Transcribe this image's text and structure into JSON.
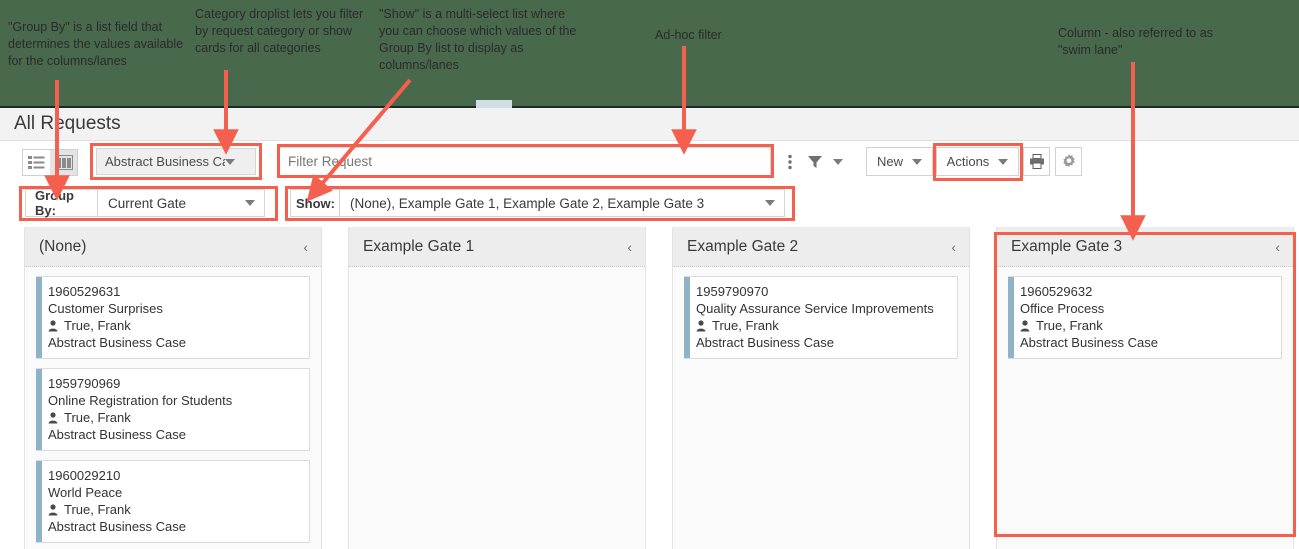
{
  "annotations": [
    {
      "id": "group-by-note",
      "text": "\"Group By\" is a list field that determines the values available for the columns/lanes"
    },
    {
      "id": "category-note",
      "text": "Category droplist lets you filter by request category or show cards for all categories"
    },
    {
      "id": "show-note",
      "text": "\"Show\" is a multi-select list where you can choose which values of the Group By list to display as columns/lanes"
    },
    {
      "id": "adhoc-filter-note",
      "text": "Ad-hoc filter"
    },
    {
      "id": "column-note",
      "text": "Column - also referred to as \"swim lane\""
    }
  ],
  "header": {
    "title": "All Requests"
  },
  "toolbar": {
    "view_list_icon": "list-view-icon",
    "view_card_icon": "card-view-icon",
    "category_value": "Abstract Business Case",
    "filter_placeholder": "Filter Request",
    "filter_value": "",
    "more_icon": "vertical-dots-icon",
    "funnel_icon": "funnel-icon",
    "funnel_caret_icon": "chevron-down-icon",
    "new_label": "New",
    "actions_label": "Actions",
    "print_icon": "printer-icon",
    "settings_icon": "gear-icon"
  },
  "controls": {
    "group_by_label": "Group By:",
    "group_by_value": "Current Gate",
    "show_label": "Show:",
    "show_value": "(None), Example Gate 1, Example Gate 2, Example Gate 3"
  },
  "board": {
    "collapse_icon": "chevron-left-icon",
    "owner_icon": "person-icon",
    "columns": [
      {
        "title": "(None)",
        "cards": [
          {
            "id": "1960529631",
            "title": "Customer Surprises",
            "owner": "True, Frank",
            "category": "Abstract Business Case"
          },
          {
            "id": "1959790969",
            "title": "Online Registration for Students",
            "owner": "True, Frank",
            "category": "Abstract Business Case"
          },
          {
            "id": "1960029210",
            "title": "World Peace",
            "owner": "True, Frank",
            "category": "Abstract Business Case"
          }
        ]
      },
      {
        "title": "Example Gate 1",
        "cards": []
      },
      {
        "title": "Example Gate 2",
        "cards": [
          {
            "id": "1959790970",
            "title": "Quality Assurance Service Improvements",
            "owner": "True, Frank",
            "category": "Abstract Business Case"
          }
        ]
      },
      {
        "title": "Example Gate 3",
        "cards": [
          {
            "id": "1960529632",
            "title": "Office Process",
            "owner": "True, Frank",
            "category": "Abstract Business Case"
          }
        ]
      }
    ]
  },
  "colors": {
    "banner": "#48694b",
    "highlight": "#f4604d",
    "card_stripe": "#8fb3c6"
  }
}
